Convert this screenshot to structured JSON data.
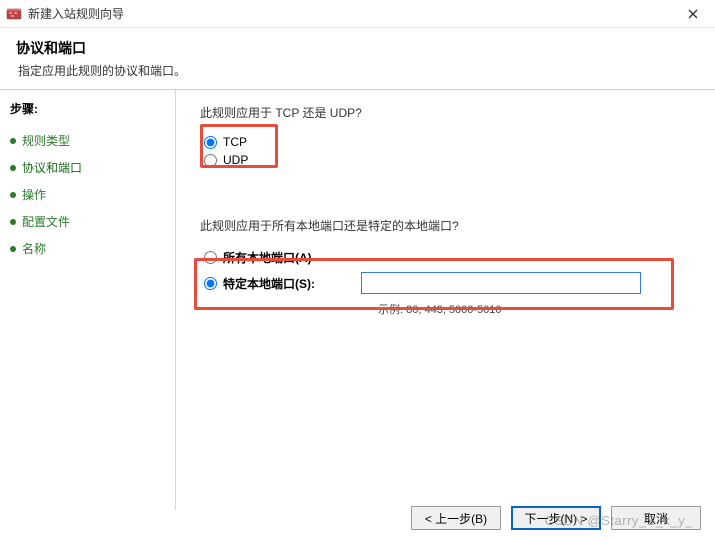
{
  "window": {
    "title": "新建入站规则向导"
  },
  "header": {
    "title": "协议和端口",
    "subtitle": "指定应用此规则的协议和端口。"
  },
  "sidebar": {
    "heading": "步骤:",
    "steps": [
      {
        "label": "规则类型"
      },
      {
        "label": "协议和端口"
      },
      {
        "label": "操作"
      },
      {
        "label": "配置文件"
      },
      {
        "label": "名称"
      }
    ]
  },
  "content": {
    "protocol_question": "此规则应用于 TCP 还是 UDP?",
    "protocol_options": {
      "tcp": "TCP",
      "udp": "UDP"
    },
    "port_question": "此规则应用于所有本地端口还是特定的本地端口?",
    "port_options": {
      "all": "所有本地端口(A)",
      "specific": "特定本地端口(S):"
    },
    "port_input": {
      "value": "",
      "placeholder": ""
    },
    "port_example": "示例: 80, 443, 5000-5010"
  },
  "footer": {
    "back": "< 上一步(B)",
    "next": "下一步(N) >",
    "cancel": "取消"
  },
  "watermark": "CSDN @Starry_S_k_y_"
}
